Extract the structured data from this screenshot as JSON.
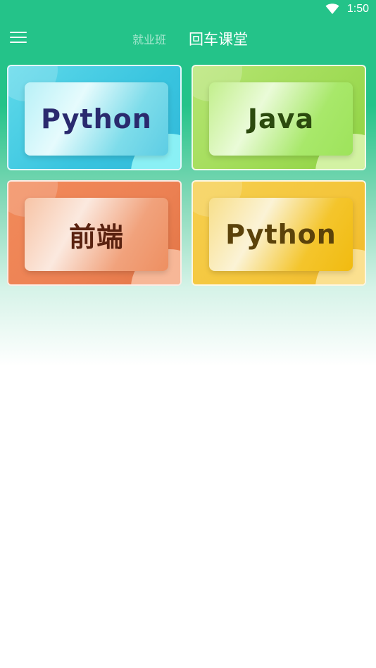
{
  "status_bar": {
    "time": "1:50",
    "wifi_icon": "wifi-icon"
  },
  "header": {
    "menu_icon": "menu-icon",
    "tabs": [
      {
        "label": "就业班",
        "active": false
      },
      {
        "label": "回车课堂",
        "active": true
      }
    ]
  },
  "courses": [
    {
      "label": "Python",
      "color": "#38c4df",
      "text_color": "#2a2a6e"
    },
    {
      "label": "Java",
      "color": "#9fdb55",
      "text_color": "#2c4a0e"
    },
    {
      "label": "前端",
      "color": "#ec8153",
      "text_color": "#5a2210"
    },
    {
      "label": "Python",
      "color": "#f4c53a",
      "text_color": "#5b420a"
    }
  ],
  "colors": {
    "header_bg": "#24c389"
  }
}
